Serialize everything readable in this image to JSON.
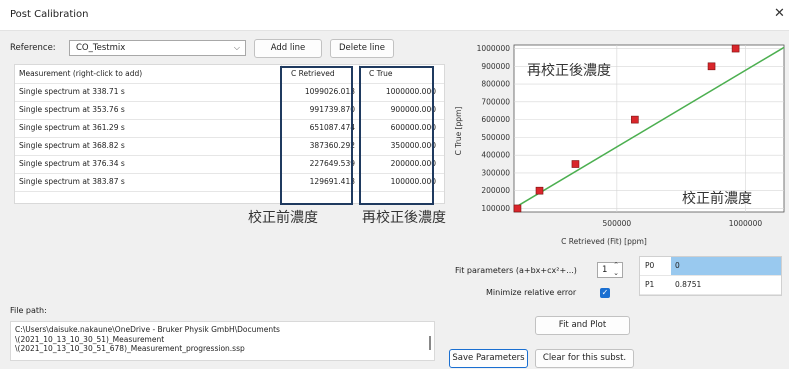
{
  "window": {
    "title": "Post Calibration",
    "close": "✕"
  },
  "toolbar": {
    "reference_label": "Reference:",
    "reference_value": "CO_Testmix",
    "add_line": "Add line",
    "delete_line": "Delete line"
  },
  "table": {
    "headers": [
      "Measurement (right-click to add)",
      "C Retrieved",
      "C True"
    ],
    "rows": [
      [
        "Single spectrum at 338.71 s",
        "1099026.013",
        "1000000.000"
      ],
      [
        "Single spectrum at 353.76 s",
        "991739.870",
        "900000.000"
      ],
      [
        "Single spectrum at 361.29 s",
        "651087.474",
        "600000.000"
      ],
      [
        "Single spectrum at 368.82 s",
        "387360.292",
        "350000.000"
      ],
      [
        "Single spectrum at 376.34 s",
        "227649.539",
        "200000.000"
      ],
      [
        "Single spectrum at 383.87 s",
        "129691.413",
        "100000.000"
      ]
    ]
  },
  "annotations": {
    "retrieved_label": "校正前濃度",
    "true_label": "再校正後濃度",
    "chart_y_label": "再校正後濃度",
    "chart_x_label": "校正前濃度"
  },
  "file": {
    "label": "File path:",
    "lines": [
      "C:\\Users\\daisuke.nakaune\\OneDrive - Bruker Physik GmbH\\Documents",
      "\\(2021_10_13_10_30_51)_Measurement",
      "\\(2021_10_13_10_30_51_678)_Measurement_progression.ssp"
    ]
  },
  "fit": {
    "params_label": "Fit parameters (a+bx+cx²+...)",
    "params_value": "1",
    "minimize_label": "Minimize relative error",
    "minimize_checked": true,
    "fit_and_plot": "Fit and Plot",
    "save_params": "Save Parameters",
    "clear_subst": "Clear for this subst.",
    "params": [
      {
        "name": "P0",
        "value": "0"
      },
      {
        "name": "P1",
        "value": "0.8751"
      }
    ]
  },
  "colors": {
    "accent": "#1a6fd1",
    "highlight_box": "#1f3a5f",
    "marker": "#d9262b",
    "fit_line": "#4caf50",
    "param_selected": "#99c9ef"
  },
  "chart_data": {
    "type": "scatter",
    "xlabel": "C Retrieved (Fit) [ppm]",
    "ylabel": "C True [ppm]",
    "x_ticks": [
      "500000",
      "1000000"
    ],
    "y_ticks": [
      "100000",
      "200000",
      "300000",
      "400000",
      "500000",
      "600000",
      "700000",
      "800000",
      "900000",
      "1000000"
    ],
    "xlim": [
      100000,
      1150000
    ],
    "ylim": [
      80000,
      1020000
    ],
    "grid": true,
    "x": [
      113500,
      199200,
      339000,
      570000,
      868200,
      961800
    ],
    "y": [
      100000,
      200000,
      350000,
      600000,
      900000,
      1000000
    ],
    "fit_line": {
      "x": [
        113500,
        1150000
      ],
      "y": [
        113500,
        1006300
      ]
    }
  }
}
